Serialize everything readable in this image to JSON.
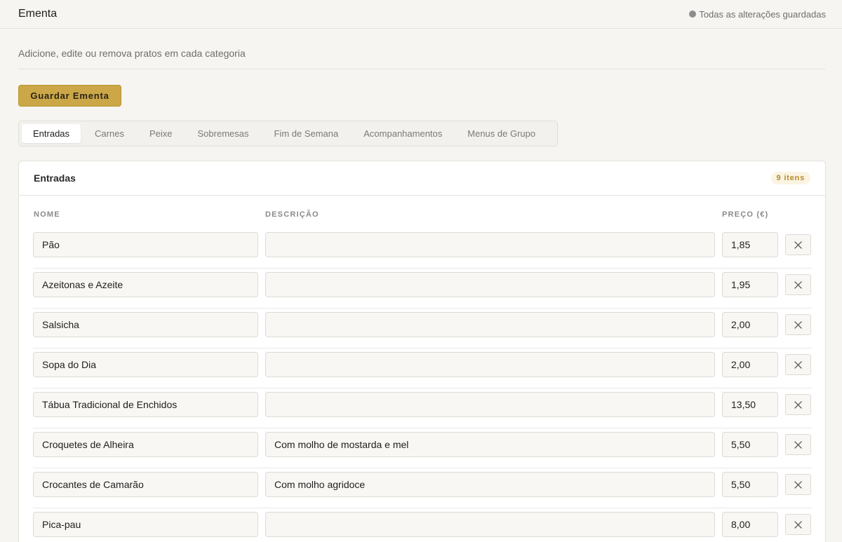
{
  "header": {
    "title": "Ementa",
    "status": "Todas as alterações guardadas"
  },
  "subtitle": "Adicione, edite ou remova pratos em cada categoria",
  "save_button": "Guardar Ementa",
  "tabs": [
    {
      "label": "Entradas",
      "active": true
    },
    {
      "label": "Carnes"
    },
    {
      "label": "Peixe"
    },
    {
      "label": "Sobremesas"
    },
    {
      "label": "Fim de Semana"
    },
    {
      "label": "Acompanhamentos"
    },
    {
      "label": "Menus de Grupo"
    }
  ],
  "section": {
    "title": "Entradas",
    "count": "9 itens",
    "columns": {
      "name": "NOME",
      "description": "DESCRIÇÃO",
      "price": "PREÇO (€)"
    },
    "items": [
      {
        "name": "Pão",
        "description": "",
        "price": "1,85"
      },
      {
        "name": "Azeitonas e Azeite",
        "description": "",
        "price": "1,95"
      },
      {
        "name": "Salsicha",
        "description": "",
        "price": "2,00"
      },
      {
        "name": "Sopa do Dia",
        "description": "",
        "price": "2,00"
      },
      {
        "name": "Tábua Tradicional de Enchidos",
        "description": "",
        "price": "13,50"
      },
      {
        "name": "Croquetes de Alheira",
        "description": "Com molho de mostarda e mel",
        "price": "5,50"
      },
      {
        "name": "Crocantes de Camarão",
        "description": "Com molho agridoce",
        "price": "5,50"
      },
      {
        "name": "Pica-pau",
        "description": "",
        "price": "8,00"
      }
    ]
  },
  "colors": {
    "accent": "#cba748",
    "background": "#f6f5f1",
    "badge_text": "#b58a2e"
  },
  "icons": {
    "status": "status-dot-icon",
    "delete": "close-icon"
  }
}
